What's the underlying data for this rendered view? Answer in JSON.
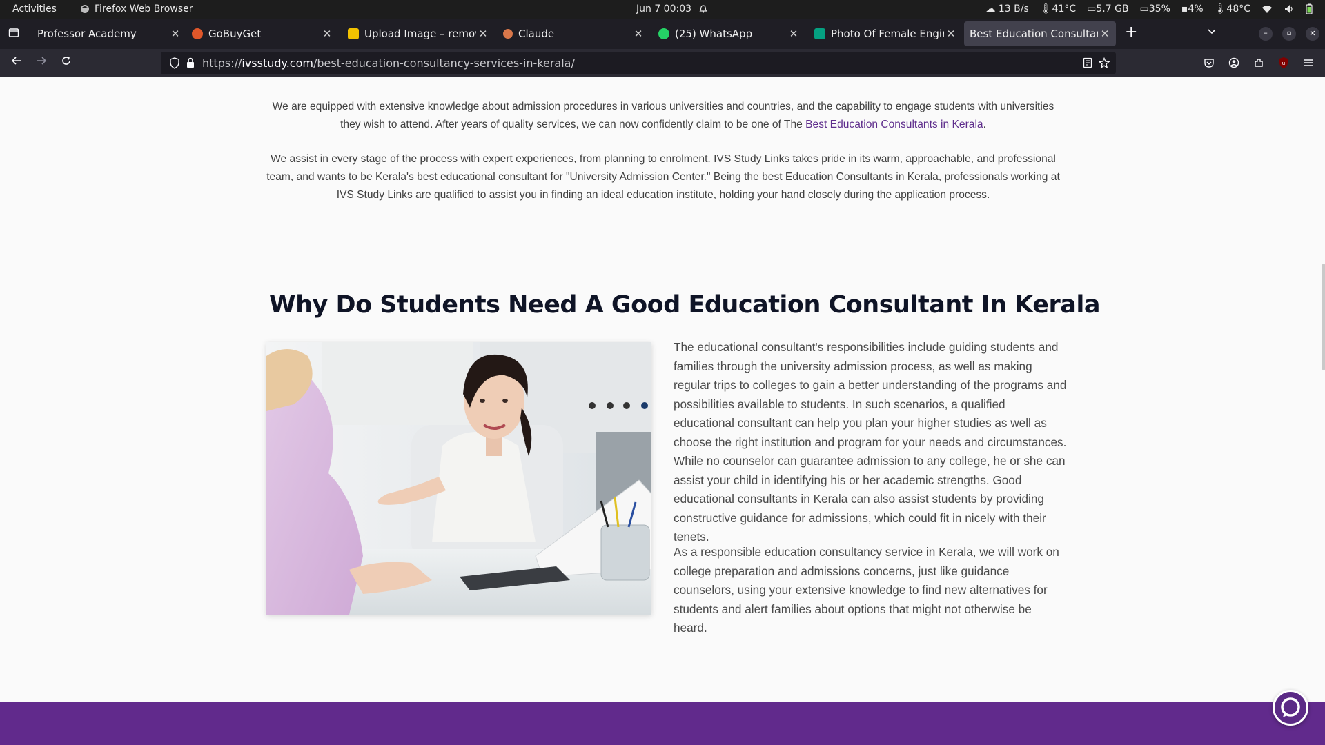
{
  "system_bar": {
    "activities": "Activities",
    "app_name": "Firefox Web Browser",
    "datetime": "Jun 7  00:03",
    "net_speed": "13 B/s",
    "cpu_temp": "41°C",
    "memory": "5.7 GB",
    "cpu_usage": "35%",
    "disk": "4%",
    "gpu_temp": "48°C"
  },
  "tabs": [
    {
      "label": "Professor Academy",
      "icon": "pin-icon",
      "color": "#9a9a9a"
    },
    {
      "label": "GoBuyGet",
      "icon": "gobuyget-favicon",
      "color": "#e0572a"
    },
    {
      "label": "Upload Image – remove.bg",
      "icon": "removebg-favicon",
      "color": "#f2c200"
    },
    {
      "label": "Claude",
      "icon": "claude-favicon",
      "color": "#d9774a"
    },
    {
      "label": "(25) WhatsApp",
      "icon": "whatsapp-favicon",
      "color": "#25d366"
    },
    {
      "label": "Photo Of Female Engineer",
      "icon": "pexels-favicon",
      "color": "#05a081"
    },
    {
      "label": "Best Education Consultancy",
      "icon": "",
      "color": ""
    }
  ],
  "url": {
    "scheme": "https://",
    "domain": "ivsstudy.com",
    "path": "/best-education-consultancy-services-in-kerala/"
  },
  "content": {
    "para1_text": "We are equipped with extensive knowledge about admission procedures in various universities and countries, and the capability to engage students with universities they wish to attend. After years of quality services, we can now confidently claim to be one of The",
    "para1_link": "Best Education Consultants in Kerala",
    "para1_end": ".",
    "para2": "We assist in every stage of the process with expert experiences, from planning to enrolment. IVS Study Links takes pride in its warm, approachable, and professional team, and wants to be Kerala's best educational consultant for \"University Admission Center.\" Being the best Education Consultants in Kerala, professionals working at IVS Study Links are qualified to assist you in finding an ideal education institute, holding your hand closely during the application process.",
    "heading": "Why Do Students Need A  Good Education Consultant  In Kerala",
    "body1": "The educational consultant's responsibilities include guiding students and families through the university admission process, as well as making regular trips to colleges to gain a better understanding of the programs and possibilities available to students. In such scenarios, a qualified educational consultant can help you plan your higher studies as well as choose the right institution and program for your needs and circumstances. While no counselor can guarantee admission to any college, he or she can assist your child in identifying his or her academic strengths. Good educational consultants in Kerala can also assist students by providing constructive guidance for admissions, which could fit in nicely with their tenets.",
    "body2": "As a responsible education consultancy service in Kerala, we will work on college preparation and admissions concerns, just like guidance counselors, using your extensive knowledge to find new alternatives for students and alert families about options that might not otherwise be heard."
  },
  "colors": {
    "brand_purple": "#612a8c",
    "link": "#5e2d8c",
    "heading": "#0f1426"
  }
}
